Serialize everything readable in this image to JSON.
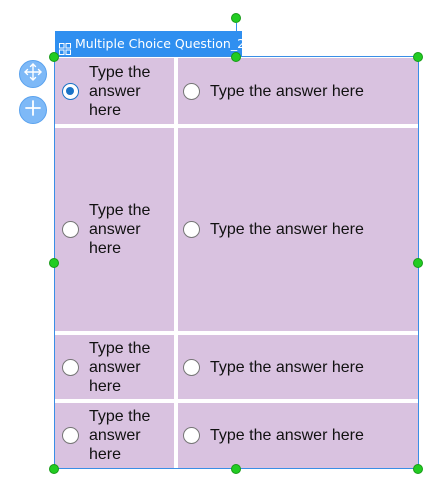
{
  "question": {
    "title": "Multiple Choice Question_2"
  },
  "choices": [
    {
      "left": "Type the answer here",
      "left_selected": true,
      "right": "Type the answer here"
    },
    {
      "left": "Type the answer here",
      "left_selected": false,
      "right": "Type the answer here"
    },
    {
      "left": "Type the answer here",
      "left_selected": false,
      "right": "Type the answer here"
    },
    {
      "left": "Type the answer here",
      "left_selected": false,
      "right": "Type the answer here"
    }
  ],
  "icons": {
    "title": "grid-icon",
    "move": "move-arrows-icon",
    "add": "plus-icon"
  },
  "colors": {
    "cell_background": "#d9c2e0",
    "selection_blue": "#2f8ff0",
    "handle_green": "#22cc22",
    "radio_selected": "#1a73c7"
  }
}
